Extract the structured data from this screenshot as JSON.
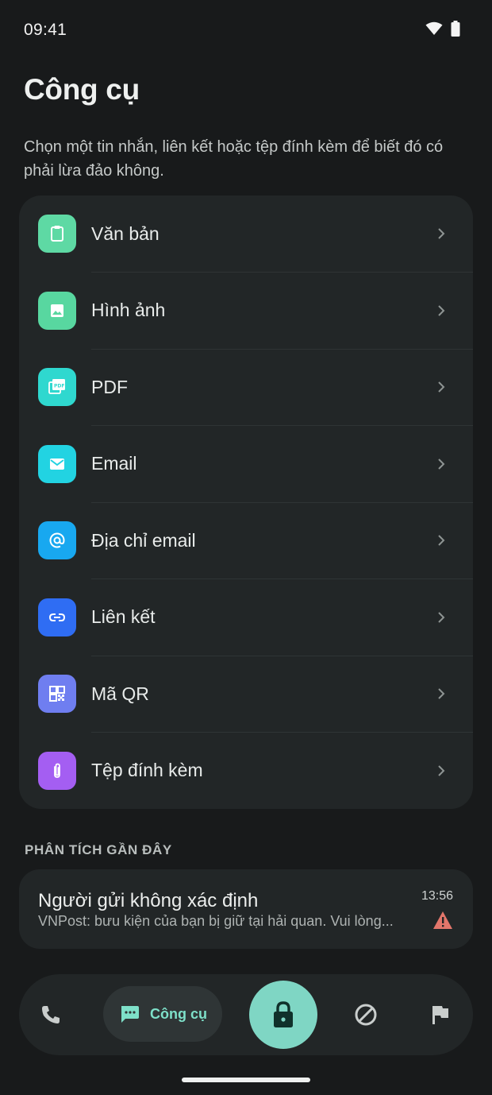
{
  "status_bar": {
    "time": "09:41"
  },
  "header": {
    "title": "Công cụ",
    "description": "Chọn một tin nhắn, liên kết hoặc tệp đính kèm để biết đó có phải lừa đảo không."
  },
  "tools": [
    {
      "label": "Văn bản",
      "icon": "clipboard-icon",
      "color": "#5ed9a4"
    },
    {
      "label": "Hình ảnh",
      "icon": "image-icon",
      "color": "#58d7a0"
    },
    {
      "label": "PDF",
      "icon": "pdf-icon",
      "color": "#2fd8cf"
    },
    {
      "label": "Email",
      "icon": "mail-icon",
      "color": "#22d3e2"
    },
    {
      "label": "Địa chỉ email",
      "icon": "at-icon",
      "color": "#18a8f0"
    },
    {
      "label": "Liên kết",
      "icon": "link-icon",
      "color": "#2f6df3"
    },
    {
      "label": "Mã QR",
      "icon": "qr-code-icon",
      "color": "#6f7ef0"
    },
    {
      "label": "Tệp đính kèm",
      "icon": "paperclip-icon",
      "color": "#a45ef2"
    }
  ],
  "recent": {
    "section_title": "PHÂN TÍCH GẦN ĐÂY",
    "items": [
      {
        "title": "Người gửi không xác định",
        "subtitle": "VNPost: bưu kiện của bạn bị giữ tại hải quan. Vui lòng...",
        "time": "13:56",
        "status_icon": "warning-icon",
        "status_color": "#e2766b"
      }
    ]
  },
  "nav": {
    "items": [
      {
        "name": "phone",
        "icon": "phone-icon"
      },
      {
        "name": "tools",
        "icon": "message-icon",
        "label": "Công cụ",
        "active": true
      },
      {
        "name": "protect",
        "icon": "lock-icon"
      },
      {
        "name": "block",
        "icon": "block-icon"
      },
      {
        "name": "report",
        "icon": "flag-icon"
      }
    ],
    "accent": "#7fd6c4"
  }
}
